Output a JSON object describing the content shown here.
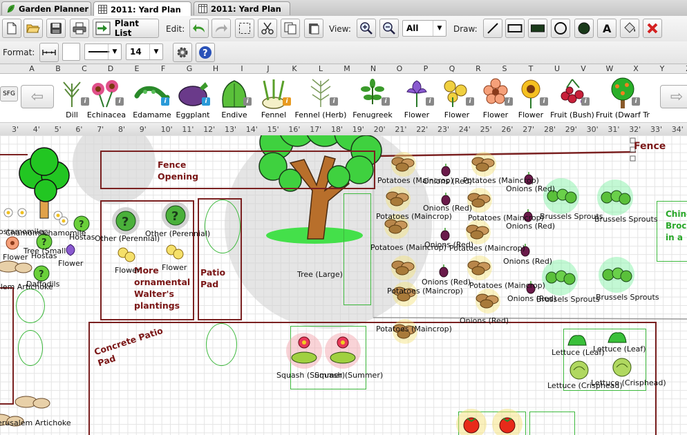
{
  "tabs": [
    {
      "label": "Garden Planner",
      "icon": "leaf-icon"
    },
    {
      "label": "2011: Yard Plan",
      "icon": "grid-icon"
    },
    {
      "label": "2011: Yard Plan",
      "icon": "table-icon"
    }
  ],
  "toolbar": {
    "plant_list_label": "Plant List",
    "edit_label": "Edit:",
    "view_label": "View:",
    "view_select": "All",
    "draw_label": "Draw:",
    "format_label": "Format:",
    "font_size": "14"
  },
  "columns": [
    "A",
    "B",
    "C",
    "D",
    "E",
    "F",
    "G",
    "H",
    "I",
    "J",
    "K",
    "L",
    "M",
    "N",
    "O",
    "P",
    "Q",
    "R",
    "S",
    "T",
    "U",
    "V",
    "W",
    "X",
    "Y",
    "Z"
  ],
  "sfg_label": "SFG",
  "plants": [
    {
      "name": "Dill",
      "info": "grey"
    },
    {
      "name": "Echinacea",
      "info": "grey"
    },
    {
      "name": "Edamame",
      "info": "blue"
    },
    {
      "name": "Eggplant",
      "info": "blue"
    },
    {
      "name": "Endive",
      "info": "grey"
    },
    {
      "name": "Fennel",
      "info": "orange"
    },
    {
      "name": "Fennel (Herb)",
      "info": "grey"
    },
    {
      "name": "Fenugreek",
      "info": "grey"
    },
    {
      "name": "Flower",
      "info": "grey"
    },
    {
      "name": "Flower",
      "info": "grey"
    },
    {
      "name": "Flower",
      "info": "grey"
    },
    {
      "name": "Flower",
      "info": "grey"
    },
    {
      "name": "Fruit (Bush)",
      "info": "grey"
    },
    {
      "name": "Fruit (Dwarf Tr",
      "info": "grey"
    }
  ],
  "ruler": [
    "3'",
    "4'",
    "5'",
    "6'",
    "7'",
    "8'",
    "9'",
    "10'",
    "11'",
    "12'",
    "13'",
    "14'",
    "15'",
    "16'",
    "17'",
    "18'",
    "19'",
    "20'",
    "21'",
    "22'",
    "23'",
    "24'",
    "25'",
    "26'",
    "27'",
    "28'",
    "29'",
    "30'",
    "31'",
    "32'",
    "33'",
    "34'"
  ],
  "canvas": {
    "fence_opening": "Fence Opening",
    "fence": "Fence",
    "tree_large": "Tree (Large)",
    "ornamental": "More ornamental Walter's plantings",
    "patio_pad": "Patio Pad",
    "concrete_patio_pad": "Concrete Patio Pad",
    "chinese_broccoli": "Chine Broc in a",
    "labels": {
      "chamomile1": "Chamomile",
      "chamomile2": "Chamomile",
      "chamomile_left": "ostamomile",
      "hostas1": "Hostas",
      "hostas2": "Hostas",
      "tree_small": "Tree (Small",
      "flower_left": "Flower",
      "flower_mid": "Flower",
      "other_perennial1": "Other (Perennial)",
      "other_perennial2": "Other (Perennial)",
      "flower_or1": "Flower",
      "flower_or2": "Flower",
      "daffodils": "Daffodils",
      "artichoke1": "alem Artichoke",
      "artichoke2": "erusalem Artichoke",
      "potatoes1": "Potatoes (Maincrop)",
      "potatoes2": "Potatoes (Maincrop)",
      "potatoes3": "Potatoes (Maincrop)",
      "potatoes4": "Potatoes (Maincrop)",
      "potatoes5": "Potatoes (Maincrop)",
      "potatoes6": "Potatoes (Maincrop)",
      "potatoes7": "Potatoes (Maincrop)",
      "potatoes8": "Potatoes (Maincrop)",
      "potatoes9": "Potatoes (Maincrop)",
      "onions1": "Onions (Red)",
      "onions2": "Onions (Red)",
      "onions3": "Onions (Red)",
      "onions4": "Onions (Red)",
      "onions5": "Onions (Red)",
      "onions6": "Onions (Red)",
      "onions7": "Onions (Red)",
      "onions8": "Onions (Red)",
      "onions9": "Onions (Red)",
      "brussels1": "Brussels Sprouts",
      "brussels2": "Brussels Sprouts",
      "brussels3": "Brussels Sprouts",
      "brussels4": "Brussels Sprouts",
      "squash1": "Squash (Summer)",
      "squash2": "Squash (Summer)",
      "lettuce_leaf1": "Lettuce (Leaf)",
      "lettuce_leaf2": "Lettuce (Leaf)",
      "lettuce_crisp1": "Lettuce (Crisphead)",
      "lettuce_crisp2": "Lettuce (Crisphead)"
    }
  },
  "colors": {
    "zone_border": "#7a2020",
    "bed_border": "#3db93d",
    "label_maroon": "#7a1616"
  }
}
